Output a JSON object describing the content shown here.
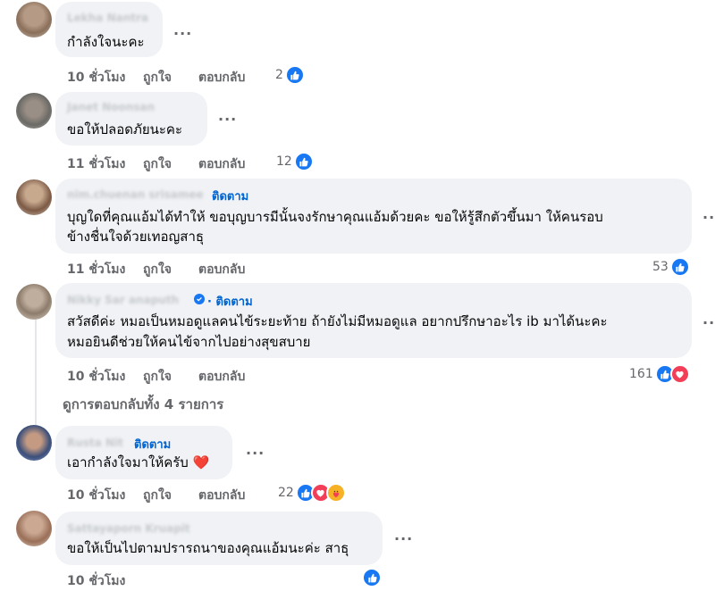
{
  "colors": {
    "bubble": "#f0f2f5",
    "link": "#0064d1",
    "like": "#1877f2",
    "love": "#f33e58",
    "care": "#f7b125",
    "meta": "#65676b"
  },
  "labels": {
    "like": "ถูกใจ",
    "reply": "ตอบกลับ",
    "follow": "ติดตาม",
    "more": "···"
  },
  "comments": [
    {
      "author": "Lekha Nantra",
      "lines": [
        "กำลังใจนะคะ"
      ],
      "time": "10 ชั่วโมง",
      "reaction_count": "2",
      "reactions": [
        "like-icon"
      ]
    },
    {
      "author": "Janet Noonsan",
      "lines": [
        "ขอให้ปลอดภัยนะคะ"
      ],
      "time": "11 ชั่วโมง",
      "reaction_count": "12",
      "reactions": [
        "like-icon"
      ]
    },
    {
      "author": "nim.chuenan srisamee",
      "follow": true,
      "lines": [
        "บุญใดที่คุณแอ้มได้ทำให้ ขอบุญบารมีนั้นจงรักษาคุณแอ้มด้วยคะ ขอให้รู้สึกตัวขึ้นมา ให้คนรอบ",
        "ข้างชื่นใจด้วยเทอญสาธุ"
      ],
      "time": "11 ชั่วโมง",
      "reaction_count": "53",
      "reactions": [
        "like-icon"
      ]
    },
    {
      "author": "Nikky Sar anaputh",
      "verified": true,
      "follow": true,
      "lines": [
        "สวัสดีค่ะ หมอเป็นหมอดูแลคนไข้ระยะท้าย ถ้ายังไม่มีหมอดูแล อยากปรึกษาอะไร ib มาได้นะคะ",
        "หมอยินดีช่วยให้คนไข้จากไปอย่างสุขสบาย"
      ],
      "time": "10 ชั่วโมง",
      "reaction_count": "161",
      "reactions": [
        "like-icon",
        "heart-icon"
      ]
    },
    {
      "author": "Rusta Nit",
      "follow": true,
      "lines": [
        "เอากำลังใจมาให้ครับ ❤️"
      ],
      "time": "10 ชั่วโมง",
      "reaction_count": "22",
      "reactions": [
        "like-icon",
        "heart-icon",
        "care-icon"
      ]
    },
    {
      "author": "Sattayaporn Kruapit",
      "lines": [
        "ขอให้เป็นไปตามปรารถนาของคุณแอ้มนะค่ะ สาธุ"
      ],
      "time": "10 ชั่วโมง",
      "reaction_count": "",
      "reactions": [
        "like-icon"
      ]
    }
  ],
  "view_replies": "ดูการตอบกลับทั้ง 4 รายการ"
}
